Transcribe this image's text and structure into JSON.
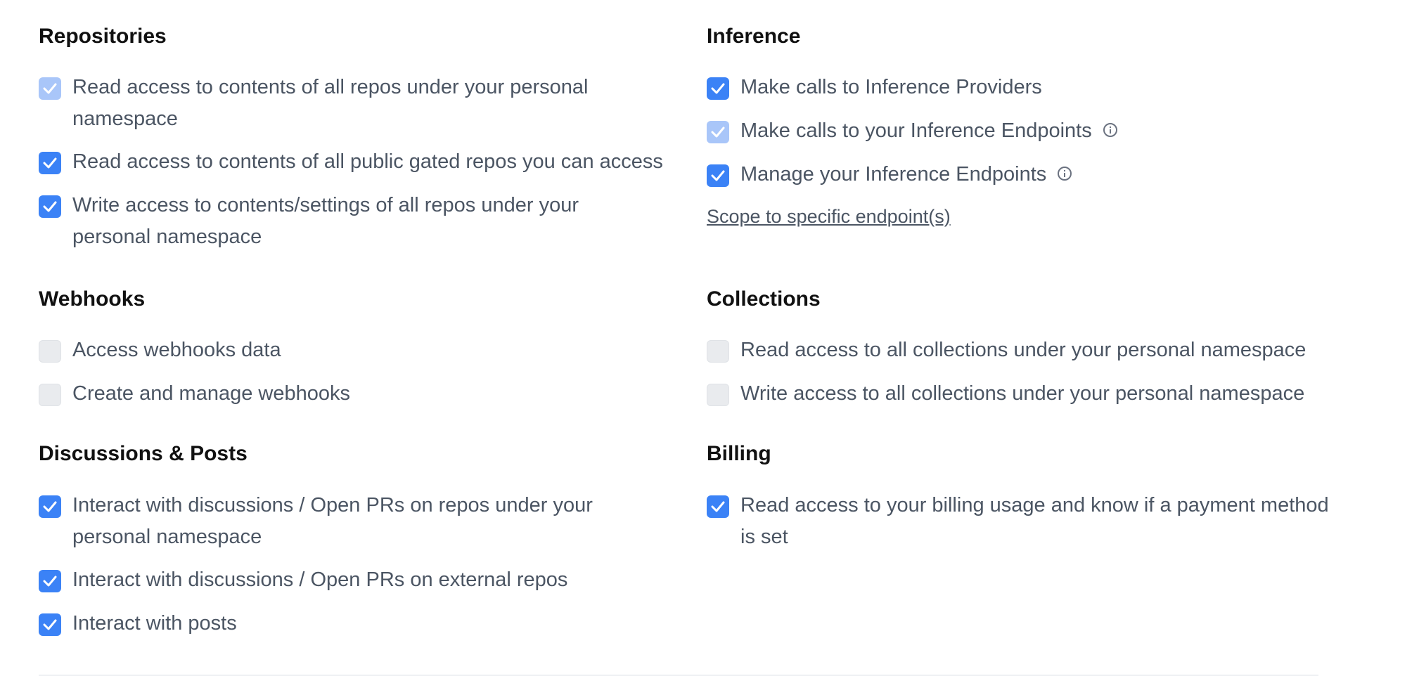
{
  "sections": {
    "repositories": {
      "title": "Repositories",
      "options": [
        {
          "label": "Read access to contents of all repos under your personal namespace",
          "state": "checked-disabled"
        },
        {
          "label": "Read access to contents of all public gated repos you can access",
          "state": "checked"
        },
        {
          "label": "Write access to contents/settings of all repos under your personal namespace",
          "state": "checked"
        }
      ]
    },
    "inference": {
      "title": "Inference",
      "options": [
        {
          "label": "Make calls to Inference Providers",
          "state": "checked"
        },
        {
          "label": "Make calls to your Inference Endpoints",
          "state": "checked-disabled",
          "info_icon": "info-icon"
        },
        {
          "label": "Manage your Inference Endpoints",
          "state": "checked",
          "info_icon": "info-icon"
        }
      ],
      "scope_link": "Scope to specific endpoint(s)"
    },
    "webhooks": {
      "title": "Webhooks",
      "options": [
        {
          "label": "Access webhooks data",
          "state": "unchecked"
        },
        {
          "label": "Create and manage webhooks",
          "state": "unchecked"
        }
      ]
    },
    "collections": {
      "title": "Collections",
      "options": [
        {
          "label": "Read access to all collections under your personal namespace",
          "state": "unchecked"
        },
        {
          "label": "Write access to all collections under your personal namespace",
          "state": "unchecked"
        }
      ]
    },
    "discussions": {
      "title": "Discussions & Posts",
      "options": [
        {
          "label": "Interact with discussions / Open PRs on repos under your personal namespace",
          "state": "checked"
        },
        {
          "label": "Interact with discussions / Open PRs on external repos",
          "state": "checked"
        },
        {
          "label": "Interact with posts",
          "state": "checked"
        }
      ]
    },
    "billing": {
      "title": "Billing",
      "options": [
        {
          "label": "Read access to your billing usage and know if a payment method is set",
          "state": "checked"
        }
      ]
    }
  },
  "colors": {
    "checkbox_checked": "#3b82f6",
    "checkbox_checked_disabled": "#a9c6f9",
    "checkbox_unchecked": "#e9ebee",
    "title_text": "#111111",
    "label_text": "#4b5563"
  }
}
